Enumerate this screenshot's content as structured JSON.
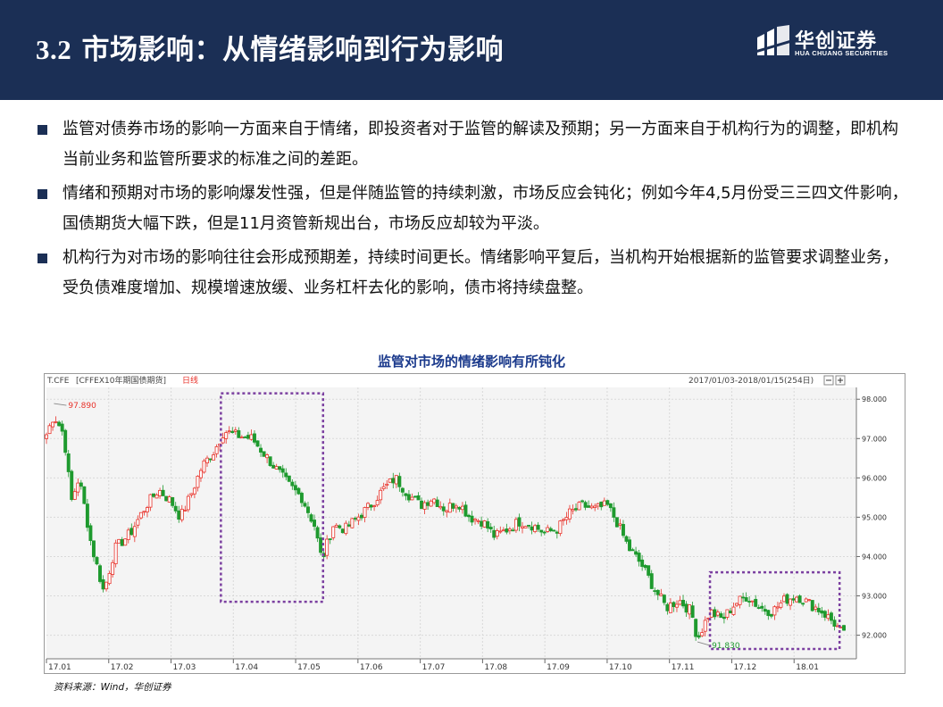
{
  "header": {
    "section_number": "3.2",
    "title": "市场影响：从情绪影响到行为影响",
    "logo_cn": "华创证券",
    "logo_en": "HUA CHUANG SECURITIES"
  },
  "bullets": [
    "监管对债券市场的影响一方面来自于情绪，即投资者对于监管的解读及预期；另一方面来自于机构行为的调整，即机构当前业务和监管所要求的标准之间的差距。",
    "情绪和预期对市场的影响爆发性强，但是伴随监管的持续刺激，市场反应会钝化；例如今年4,5月份受三三四文件影响，国债期货大幅下跌，但是11月资管新规出台，市场反应却较为平淡。",
    "机构行为对市场的影响往往会形成预期差，持续时间更长。情绪影响平复后，当机构开始根据新的监管要求调整业务，受负债难度增加、规模增速放缓、业务杠杆去化的影响，债市将持续盘整。"
  ],
  "chart_title": "监管对市场的情绪影响有所钝化",
  "source": "资料来源：Wind，华创证券",
  "colors": {
    "header_bg": "#1b2f55",
    "chart_title": "#1b3a8c",
    "up": "#e8322a",
    "down": "#1e9a2e",
    "highlight": "#7b3fa0"
  },
  "chart_data": {
    "type": "candlestick",
    "header_left_code": "T.CFE",
    "header_left_name": "[CFFEX10年期国债期货]",
    "header_left_period": "日线",
    "header_right": "2017/01/03-2018/01/15(254日)",
    "x_labels": [
      "17.01",
      "17.02",
      "17.03",
      "17.04",
      "17.05",
      "17.06",
      "17.07",
      "17.08",
      "17.09",
      "17.10",
      "17.11",
      "17.12",
      "18.01"
    ],
    "y_ticks": [
      92.0,
      93.0,
      94.0,
      95.0,
      96.0,
      97.0,
      98.0
    ],
    "y_tick_labels": [
      "92.000",
      "93.000",
      "94.000",
      "95.000",
      "96.000",
      "97.000",
      "98.000"
    ],
    "ylim": [
      91.4,
      98.3
    ],
    "grid": true,
    "annotations": [
      {
        "text": "97.890",
        "label": "high",
        "x": 0.12,
        "value": 97.89
      },
      {
        "text": "91.830",
        "label": "low",
        "x": 10.45,
        "value": 91.83
      }
    ],
    "highlights": [
      {
        "x0": 2.8,
        "x1": 4.44,
        "y0": 92.85,
        "y1": 98.15
      },
      {
        "x0": 10.65,
        "x1": 12.73,
        "y0": 91.65,
        "y1": 93.6
      }
    ],
    "anchors": [
      [
        0.0,
        97.1
      ],
      [
        0.12,
        97.6
      ],
      [
        0.28,
        97.1
      ],
      [
        0.4,
        95.4
      ],
      [
        0.52,
        96.0
      ],
      [
        0.62,
        95.2
      ],
      [
        0.72,
        94.3
      ],
      [
        0.92,
        93.1
      ],
      [
        1.1,
        94.2
      ],
      [
        1.35,
        94.6
      ],
      [
        1.6,
        95.3
      ],
      [
        1.8,
        95.7
      ],
      [
        2.0,
        95.4
      ],
      [
        2.15,
        95.0
      ],
      [
        2.3,
        95.5
      ],
      [
        2.5,
        96.3
      ],
      [
        2.7,
        96.7
      ],
      [
        2.85,
        97.2
      ],
      [
        3.0,
        97.1
      ],
      [
        3.3,
        97.0
      ],
      [
        3.5,
        96.6
      ],
      [
        3.7,
        96.2
      ],
      [
        3.9,
        95.8
      ],
      [
        4.1,
        95.5
      ],
      [
        4.3,
        94.8
      ],
      [
        4.42,
        93.9
      ],
      [
        4.6,
        94.8
      ],
      [
        4.8,
        94.7
      ],
      [
        5.0,
        95.0
      ],
      [
        5.2,
        95.3
      ],
      [
        5.4,
        95.7
      ],
      [
        5.6,
        96.0
      ],
      [
        5.8,
        95.6
      ],
      [
        6.0,
        95.3
      ],
      [
        6.2,
        95.5
      ],
      [
        6.4,
        95.2
      ],
      [
        6.6,
        95.4
      ],
      [
        6.8,
        95.0
      ],
      [
        7.0,
        94.9
      ],
      [
        7.2,
        94.5
      ],
      [
        7.4,
        94.7
      ],
      [
        7.6,
        94.9
      ],
      [
        7.8,
        94.8
      ],
      [
        8.0,
        94.6
      ],
      [
        8.2,
        94.7
      ],
      [
        8.4,
        95.1
      ],
      [
        8.6,
        95.3
      ],
      [
        8.8,
        95.2
      ],
      [
        9.0,
        95.3
      ],
      [
        9.15,
        94.9
      ],
      [
        9.35,
        94.2
      ],
      [
        9.55,
        93.8
      ],
      [
        9.75,
        93.2
      ],
      [
        9.95,
        92.7
      ],
      [
        10.15,
        92.9
      ],
      [
        10.35,
        92.6
      ],
      [
        10.45,
        91.9
      ],
      [
        10.65,
        92.6
      ],
      [
        10.85,
        92.4
      ],
      [
        11.05,
        92.8
      ],
      [
        11.25,
        93.0
      ],
      [
        11.45,
        92.7
      ],
      [
        11.65,
        92.6
      ],
      [
        11.85,
        92.9
      ],
      [
        12.05,
        93.0
      ],
      [
        12.25,
        92.8
      ],
      [
        12.45,
        92.6
      ],
      [
        12.65,
        92.3
      ],
      [
        12.8,
        92.0
      ]
    ]
  }
}
